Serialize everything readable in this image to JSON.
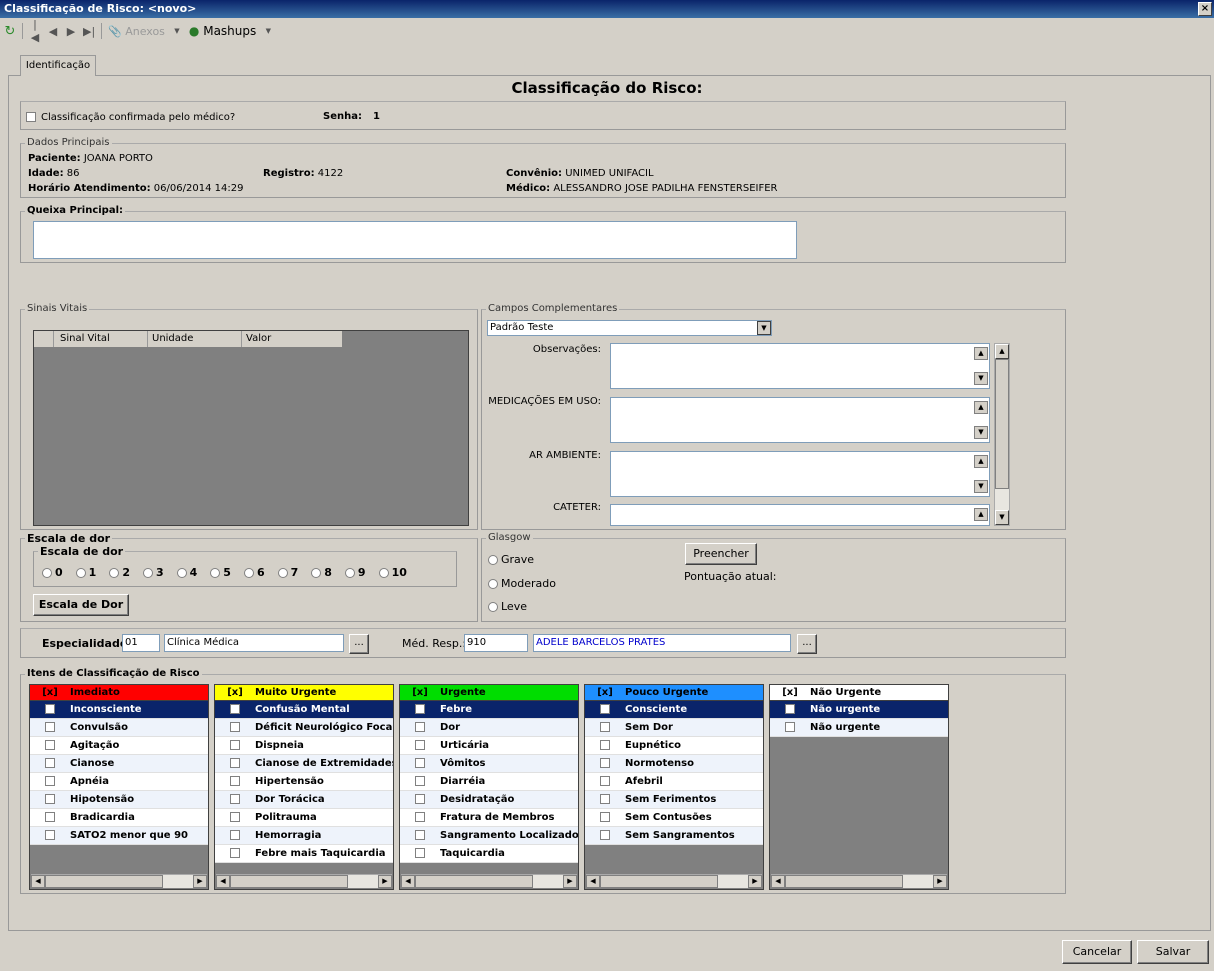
{
  "window": {
    "title": "Classificação de Risco: <novo>",
    "close": "×"
  },
  "toolbar": {
    "anexos": "Anexos",
    "mashups": "Mashups"
  },
  "tab": "Identificação",
  "header": {
    "title": "Classificação do Risco:"
  },
  "confirm": {
    "label": "Classificação confirmada pelo médico?",
    "senha_label": "Senha:",
    "senha_value": "1"
  },
  "dados": {
    "legend": "Dados Principais",
    "paciente_label": "Paciente:",
    "paciente": "JOANA PORTO",
    "idade_label": "Idade:",
    "idade": "86",
    "registro_label": "Registro:",
    "registro": "4122",
    "convenio_label": "Convênio:",
    "convenio": "UNIMED UNIFACIL",
    "horario_label": "Horário Atendimento:",
    "horario": "06/06/2014 14:29",
    "medico_label": "Médico:",
    "medico": "ALESSANDRO JOSE PADILHA FENSTERSEIFER"
  },
  "queixa": {
    "legend": "Queixa Principal:",
    "value": ""
  },
  "sinais": {
    "legend": "Sinais Vitais",
    "columns": [
      "Sinal Vital",
      "Unidade",
      "Valor"
    ]
  },
  "complementares": {
    "legend": "Campos Complementares",
    "select": "Padrão Teste",
    "fields": [
      "Observações:",
      "MEDICAÇÕES EM USO:",
      "AR AMBIENTE:",
      "CATETER:"
    ]
  },
  "dor": {
    "legend": "Escala de dor",
    "inner_legend": "Escala de dor",
    "options": [
      "0",
      "1",
      "2",
      "3",
      "4",
      "5",
      "6",
      "7",
      "8",
      "9",
      "10"
    ],
    "button": "Escala de Dor"
  },
  "glasgow": {
    "legend": "Glasgow",
    "options": [
      "Grave",
      "Moderado",
      "Leve"
    ],
    "button": "Preencher",
    "pontuacao": "Pontuação atual:"
  },
  "especialidade": {
    "label": "Especialidade:",
    "code": "01",
    "name": "Clínica Médica",
    "med_label": "Méd. Resp.:",
    "med_code": "910",
    "med_name": "ADELE BARCELOS PRATES",
    "dots": "..."
  },
  "itens": {
    "legend": "Itens de Classificação de Risco",
    "check_header": "[x]",
    "categories": [
      {
        "name": "Imediato",
        "color": "#ff0000",
        "text": "#000000",
        "items": [
          "Inconsciente",
          "Convulsão",
          "Agitação",
          "Cianose",
          "Apnéia",
          "Hipotensão",
          "Bradicardia",
          "SATO2 menor que 90"
        ]
      },
      {
        "name": "Muito Urgente",
        "color": "#ffff00",
        "text": "#000000",
        "items": [
          "Confusão Mental",
          "Déficit Neurológico Focal",
          "Dispneia",
          "Cianose de Extremidades",
          "Hipertensão",
          "Dor Torácica",
          "Politrauma",
          "Hemorragia",
          "Febre mais Taquicardia"
        ]
      },
      {
        "name": "Urgente",
        "color": "#00dd00",
        "text": "#000000",
        "items": [
          "Febre",
          "Dor",
          "Urticária",
          "Vômitos",
          "Diarréia",
          "Desidratação",
          "Fratura de Membros",
          "Sangramento Localizado",
          "Taquicardia"
        ]
      },
      {
        "name": "Pouco Urgente",
        "color": "#1e8fff",
        "text": "#000000",
        "items": [
          "Consciente",
          "Sem Dor",
          "Eupnético",
          "Normotenso",
          "Afebril",
          "Sem Ferimentos",
          "Sem Contusões",
          "Sem Sangramentos"
        ]
      },
      {
        "name": "Não Urgente",
        "color": "#ffffff",
        "text": "#000000",
        "items": [
          "Não urgente",
          "Não urgente"
        ]
      }
    ]
  },
  "footer": {
    "cancel": "Cancelar",
    "save": "Salvar"
  }
}
